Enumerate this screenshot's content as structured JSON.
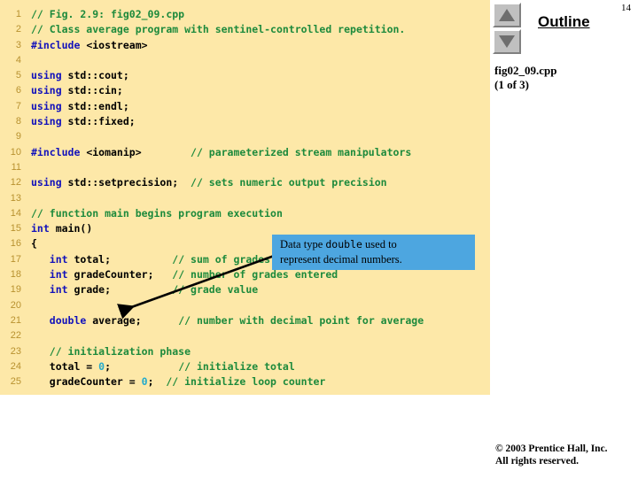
{
  "slide": {
    "page_number": "14",
    "background_color": "#ffffff"
  },
  "code_panel": {
    "background_color": "#fde8a8",
    "line_number_color": "#b8912f",
    "keyword_color": "#1111bb",
    "comment_color": "#1d8a3c",
    "number_color": "#22aacc",
    "lines": [
      {
        "n": "1",
        "parts": [
          {
            "t": "// Fig. 2.9: fig02_09.cpp",
            "c": "cm"
          }
        ]
      },
      {
        "n": "2",
        "parts": [
          {
            "t": "// Class average program with sentinel-controlled repetition.",
            "c": "cm"
          }
        ]
      },
      {
        "n": "3",
        "parts": [
          {
            "t": "#include ",
            "c": "pp"
          },
          {
            "t": "<iostream>",
            "c": "pl"
          }
        ]
      },
      {
        "n": "4",
        "parts": [
          {
            "t": "",
            "c": "pl"
          }
        ]
      },
      {
        "n": "5",
        "parts": [
          {
            "t": "using ",
            "c": "kw"
          },
          {
            "t": "std::cout;",
            "c": "pl"
          }
        ]
      },
      {
        "n": "6",
        "parts": [
          {
            "t": "using ",
            "c": "kw"
          },
          {
            "t": "std::cin;",
            "c": "pl"
          }
        ]
      },
      {
        "n": "7",
        "parts": [
          {
            "t": "using ",
            "c": "kw"
          },
          {
            "t": "std::endl;",
            "c": "pl"
          }
        ]
      },
      {
        "n": "8",
        "parts": [
          {
            "t": "using ",
            "c": "kw"
          },
          {
            "t": "std::fixed;",
            "c": "pl"
          }
        ]
      },
      {
        "n": "9",
        "parts": [
          {
            "t": "",
            "c": "pl"
          }
        ]
      },
      {
        "n": "10",
        "parts": [
          {
            "t": "#include ",
            "c": "pp"
          },
          {
            "t": "<iomanip>        ",
            "c": "pl"
          },
          {
            "t": "// parameterized stream manipulators",
            "c": "cm"
          }
        ]
      },
      {
        "n": "11",
        "parts": [
          {
            "t": "",
            "c": "pl"
          }
        ]
      },
      {
        "n": "12",
        "parts": [
          {
            "t": "using ",
            "c": "kw"
          },
          {
            "t": "std::setprecision;  ",
            "c": "pl"
          },
          {
            "t": "// sets numeric output precision",
            "c": "cm"
          }
        ]
      },
      {
        "n": "13",
        "parts": [
          {
            "t": "",
            "c": "pl"
          }
        ]
      },
      {
        "n": "14",
        "parts": [
          {
            "t": "// function main begins program execution",
            "c": "cm"
          }
        ]
      },
      {
        "n": "15",
        "parts": [
          {
            "t": "int ",
            "c": "kw"
          },
          {
            "t": "main()",
            "c": "pl"
          }
        ]
      },
      {
        "n": "16",
        "parts": [
          {
            "t": "{",
            "c": "pl"
          }
        ]
      },
      {
        "n": "17",
        "parts": [
          {
            "t": "   ",
            "c": "pl"
          },
          {
            "t": "int ",
            "c": "kw"
          },
          {
            "t": "total;          ",
            "c": "pl"
          },
          {
            "t": "// sum of grades",
            "c": "cm"
          }
        ]
      },
      {
        "n": "18",
        "parts": [
          {
            "t": "   ",
            "c": "pl"
          },
          {
            "t": "int ",
            "c": "kw"
          },
          {
            "t": "gradeCounter;   ",
            "c": "pl"
          },
          {
            "t": "// number of grades entered",
            "c": "cm"
          }
        ]
      },
      {
        "n": "19",
        "parts": [
          {
            "t": "   ",
            "c": "pl"
          },
          {
            "t": "int ",
            "c": "kw"
          },
          {
            "t": "grade;          ",
            "c": "pl"
          },
          {
            "t": "// grade value",
            "c": "cm"
          }
        ]
      },
      {
        "n": "20",
        "parts": [
          {
            "t": "",
            "c": "pl"
          }
        ]
      },
      {
        "n": "21",
        "parts": [
          {
            "t": "   ",
            "c": "pl"
          },
          {
            "t": "double ",
            "c": "kw"
          },
          {
            "t": "average;      ",
            "c": "pl"
          },
          {
            "t": "// number with decimal point for average",
            "c": "cm"
          }
        ]
      },
      {
        "n": "22",
        "parts": [
          {
            "t": "",
            "c": "pl"
          }
        ]
      },
      {
        "n": "23",
        "parts": [
          {
            "t": "   ",
            "c": "pl"
          },
          {
            "t": "// initialization phase",
            "c": "cm"
          }
        ]
      },
      {
        "n": "24",
        "parts": [
          {
            "t": "   total = ",
            "c": "pl"
          },
          {
            "t": "0",
            "c": "num"
          },
          {
            "t": ";           ",
            "c": "pl"
          },
          {
            "t": "// initialize total",
            "c": "cm"
          }
        ]
      },
      {
        "n": "25",
        "parts": [
          {
            "t": "   gradeCounter = ",
            "c": "pl"
          },
          {
            "t": "0",
            "c": "num"
          },
          {
            "t": ";  ",
            "c": "pl"
          },
          {
            "t": "// initialize loop counter",
            "c": "cm"
          }
        ]
      }
    ]
  },
  "callout": {
    "background_color": "#4da6e0",
    "text_before": "Data type ",
    "text_code": "double",
    "text_after": " used to",
    "text_line2": "represent decimal numbers."
  },
  "outline": {
    "title": "Outline",
    "scroll_up_icon": "triangle-up-icon",
    "scroll_down_icon": "triangle-down-icon",
    "file_name": "fig02_09.cpp",
    "file_part": "(1 of 3)"
  },
  "footer": {
    "copyright": "© 2003 Prentice Hall, Inc.",
    "rights": "All rights reserved."
  }
}
